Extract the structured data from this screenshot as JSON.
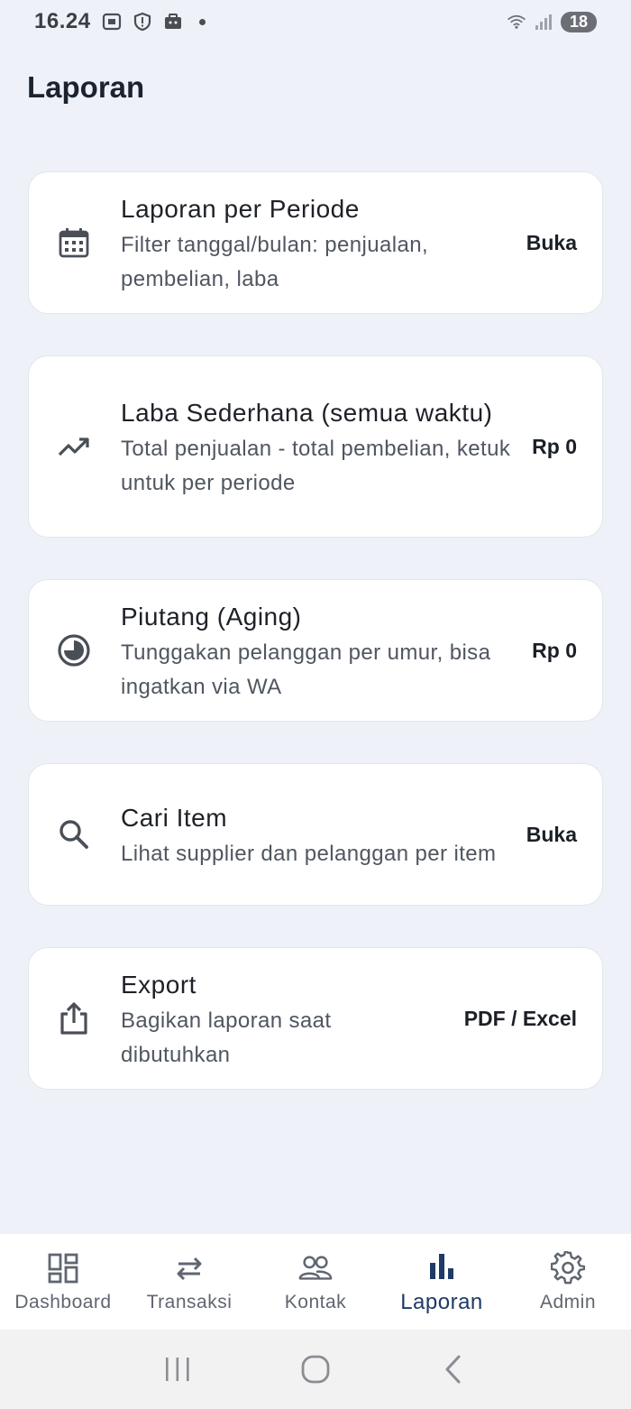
{
  "status_bar": {
    "time": "16.24",
    "battery": "18"
  },
  "header": {
    "title": "Laporan"
  },
  "cards": [
    {
      "icon": "calendar-icon",
      "title": "Laporan per Periode",
      "subtitle": "Filter tanggal/bulan: penjualan, pembelian, laba",
      "action": "Buka"
    },
    {
      "icon": "trending-up-icon",
      "title": "Laba Sederhana (semua waktu)",
      "subtitle": "Total penjualan - total pembelian, ketuk untuk per periode",
      "action": "Rp 0"
    },
    {
      "icon": "pie-clock-icon",
      "title": "Piutang (Aging)",
      "subtitle": "Tunggakan pelanggan per umur, bisa ingatkan via WA",
      "action": "Rp 0"
    },
    {
      "icon": "search-icon",
      "title": "Cari Item",
      "subtitle": "Lihat supplier dan pelanggan per item",
      "action": "Buka"
    },
    {
      "icon": "share-upload-icon",
      "title": "Export",
      "subtitle": "Bagikan laporan saat dibutuhkan",
      "action": "PDF / Excel"
    }
  ],
  "bottom_nav": {
    "items": [
      {
        "label": "Dashboard",
        "icon": "dashboard-icon"
      },
      {
        "label": "Transaksi",
        "icon": "swap-arrows-icon"
      },
      {
        "label": "Kontak",
        "icon": "people-icon"
      },
      {
        "label": "Laporan",
        "icon": "bar-chart-icon",
        "active": true
      },
      {
        "label": "Admin",
        "icon": "gear-icon"
      }
    ]
  },
  "colors": {
    "background": "#eef2f8",
    "card": "#ffffff",
    "active_nav": "#1f3a66",
    "inactive_nav": "#5f6670"
  }
}
